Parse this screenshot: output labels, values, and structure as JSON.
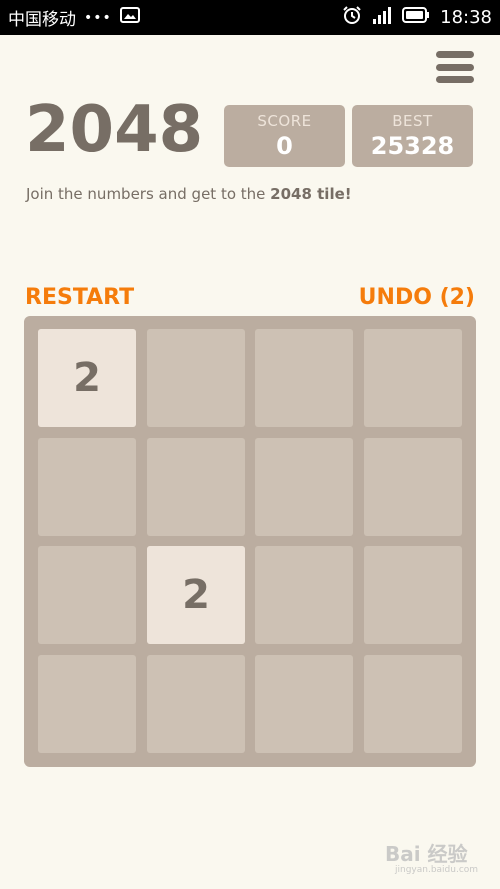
{
  "status_bar": {
    "carrier": "中国移动",
    "dots": "•••",
    "time": "18:38"
  },
  "header": {
    "title": "2048",
    "score_label": "SCORE",
    "score_value": "0",
    "best_label": "BEST",
    "best_value": "25328",
    "subtitle_prefix": "Join the numbers and get to the ",
    "subtitle_bold": "2048 tile!"
  },
  "actions": {
    "restart": "RESTART",
    "undo": "UNDO (2)"
  },
  "board": {
    "rows": [
      [
        "2",
        "",
        "",
        ""
      ],
      [
        "",
        "",
        "",
        ""
      ],
      [
        "",
        "2",
        "",
        ""
      ],
      [
        "",
        "",
        "",
        ""
      ]
    ]
  },
  "watermark": {
    "text": "Bai 经验",
    "sub": "jingyan.baidu.com"
  },
  "colors": {
    "background": "#faf8ef",
    "board": "#bbada0",
    "empty_cell": "#cdc1b4",
    "tile_2": "#eee4da",
    "text": "#776e65",
    "accent": "#f57c0b"
  }
}
